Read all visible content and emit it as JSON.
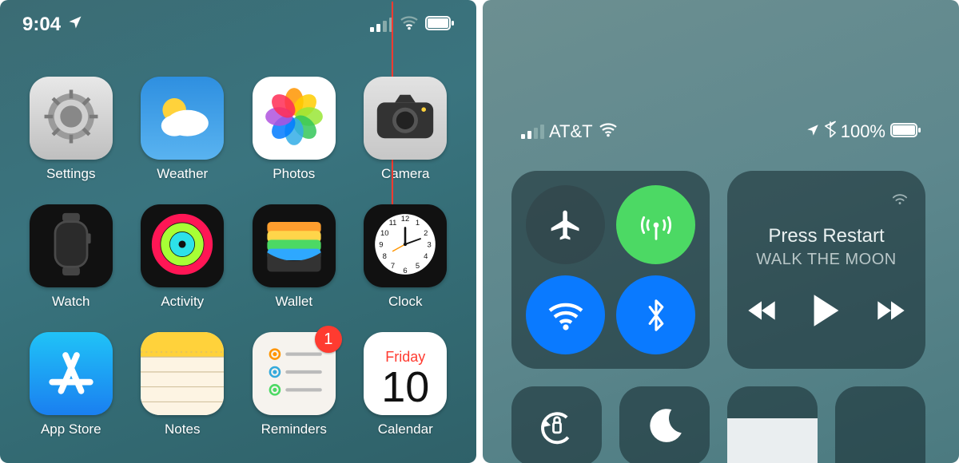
{
  "left": {
    "status": {
      "time": "9:04",
      "signal_bars": 2,
      "battery_pct": 100
    },
    "apps": [
      {
        "id": "settings",
        "label": "Settings"
      },
      {
        "id": "weather",
        "label": "Weather"
      },
      {
        "id": "photos",
        "label": "Photos"
      },
      {
        "id": "camera",
        "label": "Camera"
      },
      {
        "id": "watch",
        "label": "Watch"
      },
      {
        "id": "activity",
        "label": "Activity"
      },
      {
        "id": "wallet",
        "label": "Wallet"
      },
      {
        "id": "clock",
        "label": "Clock"
      },
      {
        "id": "appstore",
        "label": "App Store"
      },
      {
        "id": "notes",
        "label": "Notes"
      },
      {
        "id": "reminders",
        "label": "Reminders",
        "badge": "1"
      },
      {
        "id": "calendar",
        "label": "Calendar",
        "calendar_day": "Friday",
        "calendar_date": "10"
      }
    ]
  },
  "right": {
    "status": {
      "carrier": "AT&T",
      "signal_bars": 2,
      "battery_pct_text": "100%"
    },
    "toggles": {
      "airplane": {
        "state": "off"
      },
      "cellular": {
        "state": "on"
      },
      "wifi": {
        "state": "on"
      },
      "bluetooth": {
        "state": "on"
      }
    },
    "media": {
      "title": "Press Restart",
      "artist": "WALK THE MOON"
    },
    "lower": {
      "rotation_lock": {
        "state": "off"
      },
      "do_not_disturb": {
        "state": "off"
      },
      "brightness_pct": 60
    }
  }
}
